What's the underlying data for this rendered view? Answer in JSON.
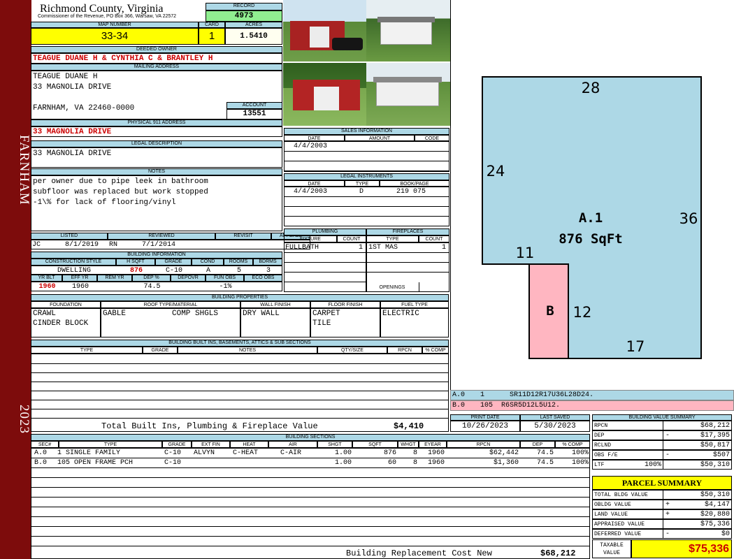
{
  "sidebar": {
    "district": "FARNHAM",
    "year": "2023"
  },
  "header": {
    "county": "Richmond County, Virginia",
    "commissioner": "Commissioner of the Revenue, PO Box 366, Warsaw, VA 22572",
    "record_label": "RECORD",
    "record": "4973",
    "map_label": "MAP NUMBER",
    "map": "33-34",
    "card_label": "CARD",
    "card": "1",
    "acres_label": "ACRES",
    "acres": "1.5410"
  },
  "owner": {
    "label": "DEEDED OWNER",
    "name": "TEAGUE DUANE H & CYNTHIA C & BRANTLEY H",
    "mail_label": "MAILING ADDRESS",
    "line1": "TEAGUE DUANE H",
    "line2": "33 MAGNOLIA DRIVE",
    "line3": "FARNHAM, VA 22460-0000",
    "account_label": "ACCOUNT",
    "account": "13551",
    "phys_label": "PHYSICAL 911 ADDRESS",
    "phys": "33 MAGNOLIA DRIVE",
    "legal_label": "LEGAL DESCRIPTION",
    "legal": "33 MAGNOLIA DRIVE",
    "notes_label": "NOTES",
    "notes": [
      "per owner due to pipe leek in bathroom",
      "subfloor was replaced but work stopped",
      "-1\\% for lack of flooring/vinyl"
    ]
  },
  "review": {
    "listed_label": "LISTED",
    "reviewed_label": "REVIEWED",
    "revisit_label": "REVISIT",
    "appeals_label": "APPEALS",
    "listed_by": "JC",
    "listed_date": "8/1/2019",
    "reviewed_by": "RN",
    "reviewed_date": "7/1/2014"
  },
  "bldg_info": {
    "label": "BUILDING INFORMATION",
    "h1": [
      "CONSTRUCTION STYLE",
      "H SQFT",
      "GRADE",
      "COND",
      "ROOMS",
      "BDRMS"
    ],
    "v1": [
      "DWELLING",
      "876",
      "C-10",
      "A",
      "5",
      "3"
    ],
    "h2": [
      "YR BLT",
      "EFF YR",
      "REM YR",
      "DEP %",
      "DEPOVR",
      "FUN OBS",
      "ECO OBS"
    ],
    "v2": [
      "1960",
      "1960",
      "",
      "74.5",
      "",
      "-1%",
      ""
    ]
  },
  "sales": {
    "label": "SALES INFORMATION",
    "headers": [
      "DATE",
      "AMOUNT",
      "CODE"
    ],
    "rows": [
      [
        "4/4/2003",
        "",
        ""
      ]
    ]
  },
  "legal_instr": {
    "label": "LEGAL INSTRUMENTS",
    "headers": [
      "DATE",
      "TYPE",
      "BOOK/PAGE"
    ],
    "rows": [
      [
        "4/4/2003",
        "D",
        "219 075"
      ]
    ]
  },
  "plumbing": {
    "label": "PLUMBING",
    "headers": [
      "FIXTURE",
      "COUNT"
    ],
    "rows": [
      [
        "FULLBATH",
        "1"
      ]
    ]
  },
  "fireplaces": {
    "label": "FIREPLACES",
    "headers": [
      "TYPE",
      "COUNT"
    ],
    "rows": [
      [
        "1ST MAS",
        "1"
      ]
    ],
    "openings_label": "OPENINGS"
  },
  "bldg_props": {
    "label": "BUILDING PROPERTIES",
    "headers": [
      "FOUNDATION",
      "ROOF TYPE/MATERIAL",
      "WALL FINISH",
      "FLOOR FINISH",
      "FUEL TYPE"
    ],
    "foundation": [
      "CRAWL",
      "CINDER BLOCK"
    ],
    "roof_type": "GABLE",
    "roof_mat": "COMP SHGLS",
    "wall": "DRY WALL",
    "floor": [
      "CARPET",
      "TILE"
    ],
    "fuel": "ELECTRIC"
  },
  "builtins": {
    "label": "BUILDING BUILT INS, BASEMENTS, ATTICS & SUB SECTIONS",
    "headers": [
      "TYPE",
      "GRADE",
      "NOTES",
      "QTY/SIZE",
      "RPCN",
      "% COMP"
    ],
    "total_label": "Total Built Ins, Plumbing & Fireplace Value",
    "total": "$4,410"
  },
  "sections": {
    "label": "BUILDING SECTIONS",
    "headers": [
      "SEC#",
      "TYPE",
      "GRADE",
      "EXT FIN",
      "HEAT",
      "AIR",
      "SHGT",
      "SQFT",
      "WHGT",
      "EYEAR",
      "RPCN",
      "DEP",
      "% COMP"
    ],
    "rows": [
      [
        "A.0",
        "1 SINGLE FAMILY",
        "C-10",
        "ALVYN",
        "C-HEAT",
        "C-AIR",
        "1.00",
        "876",
        "8",
        "1960",
        "$62,442",
        "74.5",
        "100%"
      ],
      [
        "B.0",
        "105 OPEN FRAME PCH",
        "C-10",
        "",
        "",
        "",
        "1.00",
        "60",
        "8",
        "1960",
        "$1,360",
        "74.5",
        "100%"
      ]
    ],
    "replacement_label": "Building Replacement Cost New",
    "replacement": "$68,212"
  },
  "sketch": {
    "top": "28",
    "left": "24",
    "right": "36",
    "notch_w": "11",
    "b_label": "B",
    "b_side": "12",
    "bottom": "17",
    "area_label": "A.1",
    "area": "876 SqFt",
    "lines": [
      {
        "sec": "A.0",
        "code": "1",
        "path": "SR11D12R17U36L28D24."
      },
      {
        "sec": "B.0",
        "code": "105",
        "path": "R6SR5D12L5U12."
      }
    ]
  },
  "dates": {
    "print_label": "PRINT DATE",
    "print": "10/26/2023",
    "saved_label": "LAST SAVED",
    "saved": "5/30/2023"
  },
  "value_summary": {
    "label": "BUILDING VALUE SUMMARY",
    "rows": [
      {
        "k": "RPCN",
        "op": "",
        "pct": "",
        "v": "$68,212"
      },
      {
        "k": "DEP",
        "op": "-",
        "pct": "",
        "v": "$17,395"
      },
      {
        "k": "RCLND",
        "op": "",
        "pct": "",
        "v": "$50,817"
      },
      {
        "k": "OBS F/E",
        "op": "-",
        "pct": "",
        "v": "$507"
      },
      {
        "k": "LTF",
        "op": "",
        "pct": "100%",
        "v": "$50,310"
      }
    ]
  },
  "parcel": {
    "label": "PARCEL SUMMARY",
    "rows": [
      {
        "k": "TOTAL BLDG VALUE",
        "op": "",
        "v": "$50,310"
      },
      {
        "k": "OBLDG VALUE",
        "op": "+",
        "v": "$4,147"
      },
      {
        "k": "LAND VALUE",
        "op": "+",
        "v": "$20,880"
      },
      {
        "k": "APPRAISED VALUE",
        "op": "",
        "v": "$75,336"
      },
      {
        "k": "DEFERRED VALUE",
        "op": "-",
        "v": "$0"
      }
    ],
    "taxable_label1": "TAXABLE",
    "taxable_label2": "VALUE",
    "taxable": "$75,336"
  },
  "colors": {
    "sidebar": "#7d0c0c",
    "header": "#add8e6",
    "sketch_a": "#add8e6",
    "sketch_b": "#ffb6c1",
    "highlight": "#ffff00",
    "red_text": "#cc0000"
  }
}
